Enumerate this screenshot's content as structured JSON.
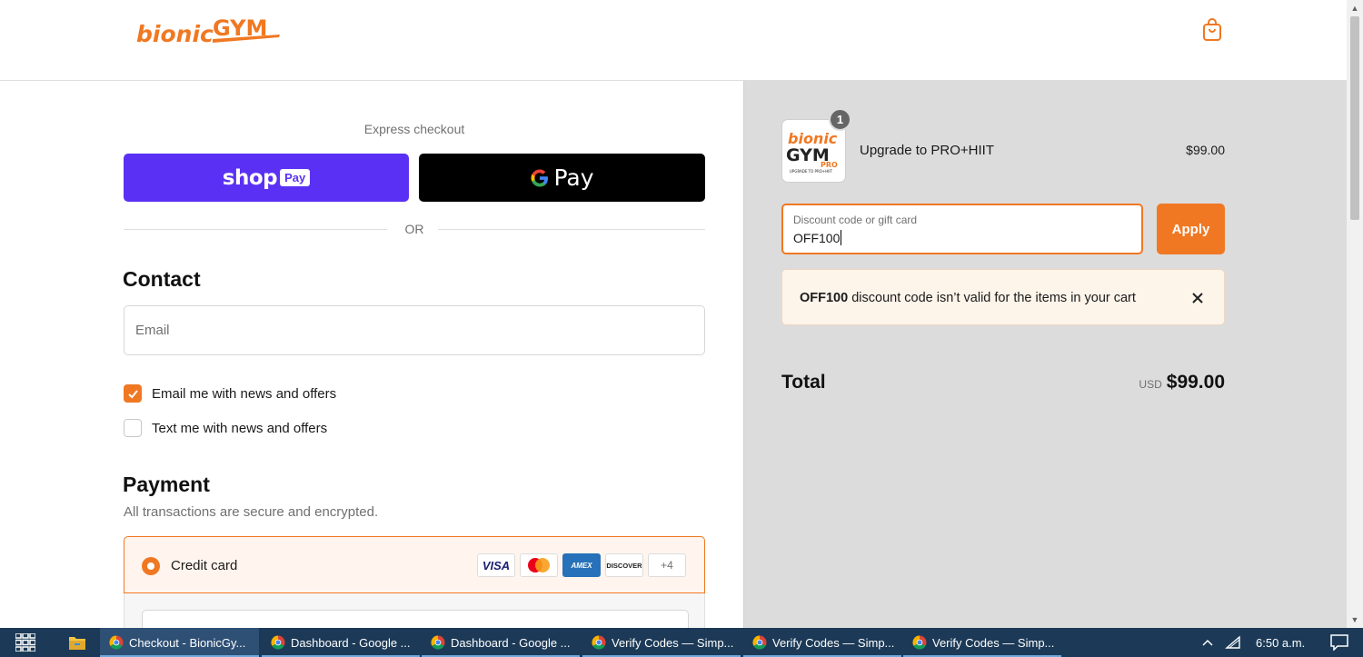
{
  "header": {
    "logo_text_left": "bionic",
    "logo_text_right": "GYM"
  },
  "express": {
    "label": "Express checkout",
    "shop_pay_word": "shop",
    "shop_pay_badge": "Pay",
    "gpay_word": "Pay",
    "or_label": "OR"
  },
  "contact": {
    "title": "Contact",
    "email_placeholder": "Email",
    "news_email_label": "Email me with news and offers",
    "news_email_checked": true,
    "news_text_label": "Text me with news and offers",
    "news_text_checked": false
  },
  "payment": {
    "title": "Payment",
    "subtitle": "All transactions are secure and encrypted.",
    "method_label": "Credit card",
    "cards": [
      "VISA",
      "MC",
      "AMEX",
      "DISCOVER"
    ],
    "more_cards": "+4"
  },
  "summary": {
    "item": {
      "quantity": "1",
      "name": "Upgrade to PRO+HIIT",
      "price": "$99.00",
      "thumb_line1": "bionic",
      "thumb_line2": "GYM",
      "thumb_line3": "PRO",
      "thumb_caption": "UPGRADE TO PRO+HIIT"
    },
    "discount": {
      "label": "Discount code or gift card",
      "value": "OFF100",
      "apply_label": "Apply"
    },
    "error": {
      "code": "OFF100",
      "message": " discount code isn’t valid for the items in your cart"
    },
    "total": {
      "label": "Total",
      "currency": "USD",
      "amount": "$99.00"
    }
  },
  "taskbar": {
    "items": [
      {
        "label": "Checkout - BionicGy..."
      },
      {
        "label": "Dashboard - Google ..."
      },
      {
        "label": "Dashboard - Google ..."
      },
      {
        "label": "Verify Codes — Simp..."
      },
      {
        "label": "Verify Codes — Simp..."
      },
      {
        "label": "Verify Codes — Simp..."
      }
    ],
    "clock": "6:50 a.m."
  },
  "colors": {
    "accent": "#f07822",
    "shop_pay": "#5a31f4",
    "summary_bg": "#dcdcdc",
    "taskbar_bg": "#1c3a57"
  }
}
